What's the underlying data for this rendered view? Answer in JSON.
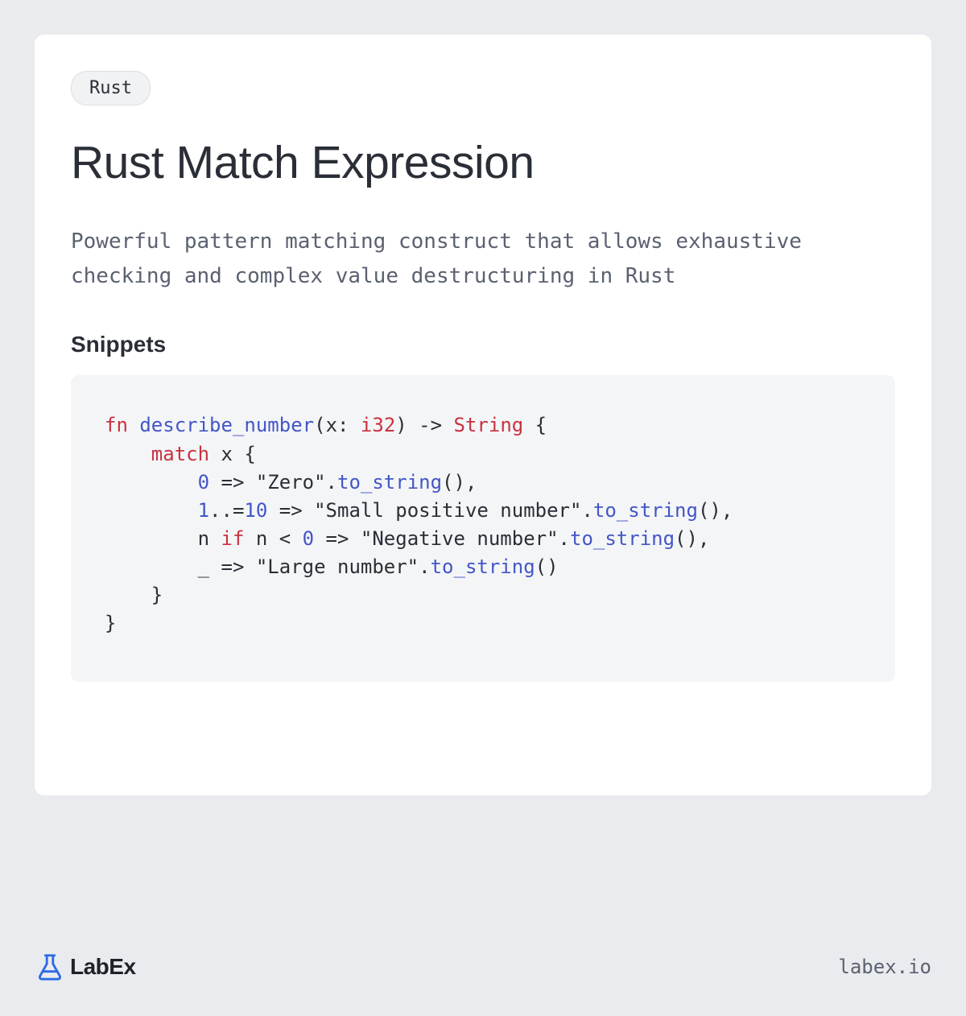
{
  "tag": "Rust",
  "title": "Rust Match Expression",
  "description": "Powerful pattern matching construct that allows exhaustive checking and complex value destructuring in Rust",
  "section_heading": "Snippets",
  "code": {
    "line1": {
      "kw_fn": "fn",
      "fn_name": "describe_number",
      "paren_open": "(",
      "param": "x: ",
      "type1": "i32",
      "paren_close": ") -> ",
      "type2": "String",
      "brace": " {"
    },
    "line2": {
      "indent": "    ",
      "kw_match": "match",
      "rest": " x {"
    },
    "line3": {
      "indent": "        ",
      "num": "0",
      "arrow": " => ",
      "str": "\"Zero\"",
      "dot": ".",
      "method": "to_string",
      "parens": "(),"
    },
    "line4": {
      "indent": "        ",
      "num1": "1",
      "range": "..=",
      "num2": "10",
      "arrow": " => ",
      "str": "\"Small positive number\"",
      "dot": ".",
      "method": "to_string",
      "parens": "(),"
    },
    "line5": {
      "indent": "        ",
      "var": "n ",
      "kw_if": "if",
      "cond": " n < ",
      "num": "0",
      "arrow": " => ",
      "str": "\"Negative number\"",
      "dot": ".",
      "method": "to_string",
      "parens": "(),"
    },
    "line6": {
      "indent": "        ",
      "wildcard": "_ => ",
      "str": "\"Large number\"",
      "dot": ".",
      "method": "to_string",
      "parens": "()"
    },
    "line7": {
      "indent": "    ",
      "brace": "}"
    },
    "line8": {
      "brace": "}"
    }
  },
  "logo_text": "LabEx",
  "site_url": "labex.io",
  "colors": {
    "accent_blue": "#2e6ae6",
    "keyword_red": "#c83240",
    "identifier_blue": "#4356c6"
  }
}
